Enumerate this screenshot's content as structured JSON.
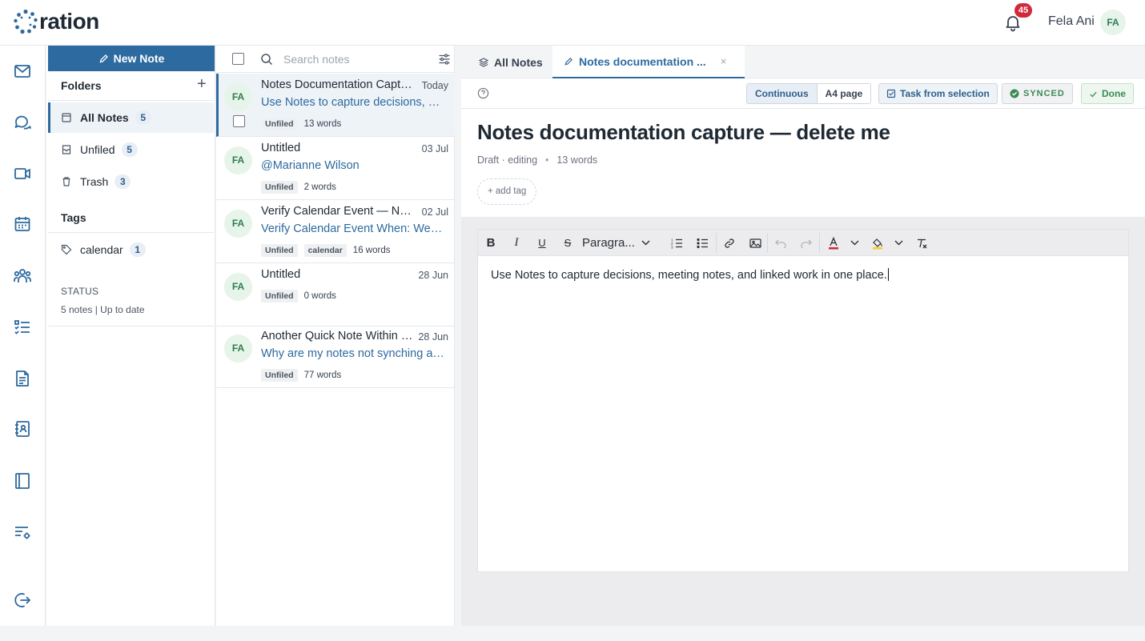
{
  "app": {
    "brand": "ration"
  },
  "topbar": {
    "notification_count": "45",
    "user_name": "Fela Ani",
    "user_initials": "FA"
  },
  "rail": {
    "icons": [
      "mail-icon",
      "chat-icon",
      "video-icon",
      "calendar-icon",
      "team-icon",
      "tasks-icon",
      "document-icon",
      "contacts-icon",
      "notebook-icon",
      "settings-list-icon",
      "logout-icon"
    ]
  },
  "folders": {
    "new_note_label": "New Note",
    "heading": "Folders",
    "add_label": "+",
    "items": [
      {
        "label": "All Notes",
        "count": "5",
        "active": true
      },
      {
        "label": "Unfiled",
        "count": "5",
        "active": false
      },
      {
        "label": "Trash",
        "count": "3",
        "active": false
      }
    ],
    "tags_heading": "Tags",
    "tags": [
      {
        "label": "calendar",
        "count": "1"
      }
    ],
    "status_label": "STATUS",
    "status_text": "5 notes | Up to date"
  },
  "notes": {
    "search_placeholder": "Search notes",
    "items": [
      {
        "initials": "FA",
        "title": "Notes Documentation Capture — delete me",
        "date": "Today",
        "preview": "Use Notes to capture decisions, meeting notes, and linked work in one place.",
        "folder": "Unfiled",
        "tags": [],
        "words": "13 words",
        "active": true
      },
      {
        "initials": "FA",
        "title": "Untitled",
        "date": "03 Jul",
        "preview": "@Marianne Wilson",
        "folder": "Unfiled",
        "tags": [],
        "words": "2 words",
        "active": false
      },
      {
        "initials": "FA",
        "title": "Verify Calendar Event — Notes link",
        "date": "02 Jul",
        "preview": "Verify Calendar Event When: Wednesday",
        "folder": "Unfiled",
        "tags": [
          "calendar"
        ],
        "words": "16 words",
        "active": false
      },
      {
        "initials": "FA",
        "title": "Untitled",
        "date": "28 Jun",
        "preview": "",
        "folder": "Unfiled",
        "tags": [],
        "words": "0 words",
        "active": false
      },
      {
        "initials": "FA",
        "title": "Another Quick Note Within Notes",
        "date": "28 Jun",
        "preview": "Why are my notes not synching automatically?",
        "folder": "Unfiled",
        "tags": [],
        "words": "77 words",
        "active": false
      }
    ]
  },
  "main": {
    "tabs": [
      {
        "label": "All Notes",
        "active": false
      },
      {
        "label": "Notes documentation ...",
        "active": true,
        "close": "×"
      }
    ],
    "view_modes": [
      "Continuous",
      "A4 page"
    ],
    "task_from_selection": "Task from selection",
    "sync_status": "SYNCED",
    "done_label": "Done",
    "doc_title": "Notes documentation capture — delete me",
    "doc_status": "Draft · editing",
    "doc_meta_sep": "•",
    "doc_words": "13 words",
    "add_tag": "+ add tag",
    "paragraph_style": "Paragra...",
    "body_text": "Use Notes to capture decisions, meeting notes, and linked work in one place."
  },
  "colors": {
    "accent": "#2d6a9f",
    "badge": "#d1283b",
    "success": "#3b8a55"
  }
}
